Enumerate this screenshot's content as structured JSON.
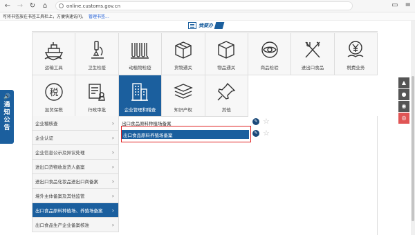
{
  "browser": {
    "url": "online.customs.gov.cn",
    "bookmark_hint": "可将书签放在书签工具栏上，方便快速访问。",
    "bookmark_link": "管理书签..."
  },
  "logo": {
    "text": "我要办"
  },
  "categories": [
    {
      "label": "运输工具",
      "icon": "ship-icon"
    },
    {
      "label": "卫生检疫",
      "icon": "microscope-icon"
    },
    {
      "label": "动植物检疫",
      "icon": "test-tubes-icon"
    },
    {
      "label": "货物通关",
      "icon": "cargo-box-icon"
    },
    {
      "label": "物品通关",
      "icon": "package-cube-icon"
    },
    {
      "label": "商品检验",
      "icon": "eye-inspect-icon"
    },
    {
      "label": "进出口食品",
      "icon": "utensils-icon"
    },
    {
      "label": "税费业务",
      "icon": "yen-coin-icon"
    },
    {
      "label": "加贸保税",
      "icon": "tax-badge-icon"
    },
    {
      "label": "行政审批",
      "icon": "approval-doc-icon"
    },
    {
      "label": "企业管理和稽查",
      "icon": "building-icon",
      "active": true
    },
    {
      "label": "知识产权",
      "icon": "books-stack-icon"
    },
    {
      "label": "其他",
      "icon": "pushpin-icon"
    }
  ],
  "submenu": [
    {
      "label": "企业稽核查"
    },
    {
      "label": "企业认证"
    },
    {
      "label": "企业信息公示及异议处理"
    },
    {
      "label": "进出口货物收发货人备案"
    },
    {
      "label": "进出口食品化妆品进出口商备案"
    },
    {
      "label": "境外主体备案及其他监管"
    },
    {
      "label": "出口食品原料种植场、养殖场备案",
      "active": true
    },
    {
      "label": "出口食品生产企业备案核准"
    }
  ],
  "services": [
    {
      "label": "出口食品原料种植场备案"
    },
    {
      "label": "出口食品原料养殖场备案",
      "selected": true
    }
  ],
  "notice": {
    "line1": "通",
    "line2": "知",
    "line3": "公",
    "line4": "告"
  },
  "float_buttons": [
    "android-icon",
    "apple-icon",
    "wechat-icon",
    "weibo-icon"
  ],
  "colors": {
    "primary": "#1b5f9e",
    "highlight_border": "#e02020"
  }
}
